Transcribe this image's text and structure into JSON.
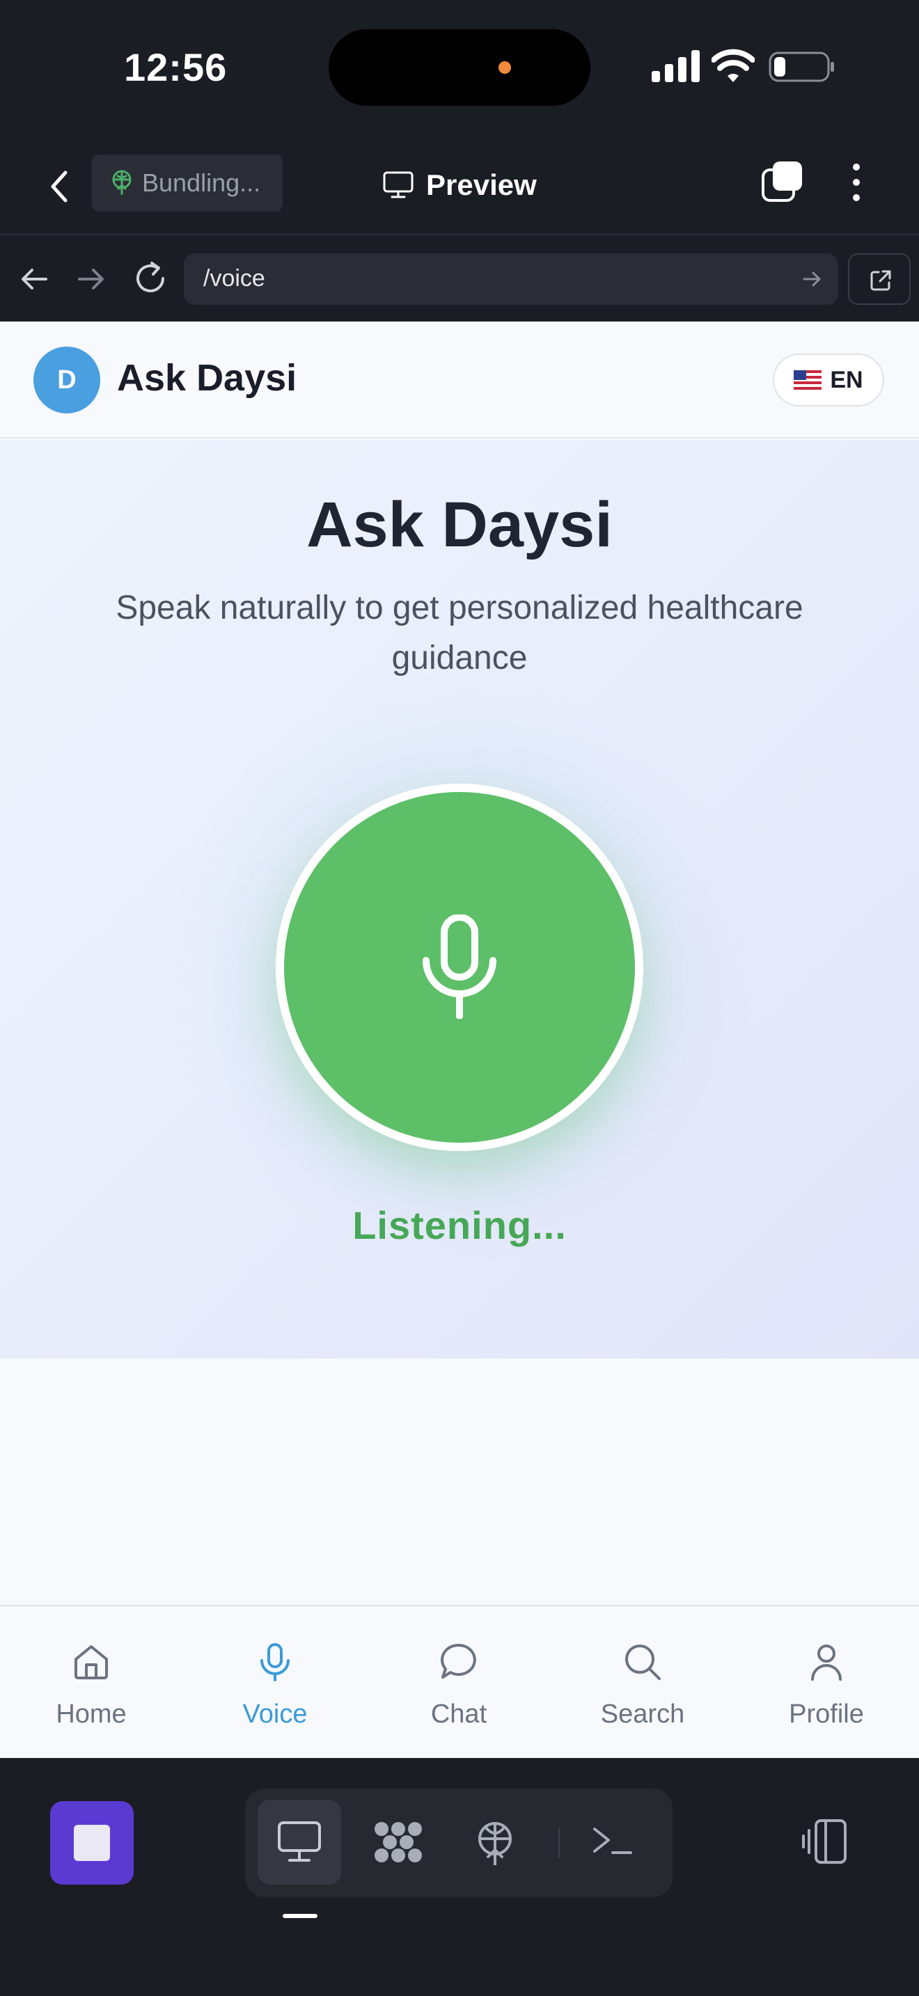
{
  "status_bar": {
    "time": "12:56"
  },
  "app_bar": {
    "bundle_label": "Bundling...",
    "preview_label": "Preview"
  },
  "url_bar": {
    "url": "/voice"
  },
  "page": {
    "header": {
      "logo_letter": "D",
      "title": "Ask Daysi",
      "language": "EN"
    },
    "hero": {
      "title": "Ask Daysi",
      "subtitle": "Speak naturally to get personalized healthcare guidance",
      "status": "Listening..."
    },
    "nav": [
      {
        "label": "Home",
        "icon": "home-icon",
        "active": false
      },
      {
        "label": "Voice",
        "icon": "mic-icon",
        "active": true
      },
      {
        "label": "Chat",
        "icon": "chat-bubble-icon",
        "active": false
      },
      {
        "label": "Search",
        "icon": "search-icon",
        "active": false
      },
      {
        "label": "Profile",
        "icon": "user-icon",
        "active": false
      }
    ]
  },
  "colors": {
    "accent_blue": "#3a9ad9",
    "mic_green": "#5dbf68",
    "listening_green": "#46a857",
    "stop_purple": "#5b3ad1"
  }
}
